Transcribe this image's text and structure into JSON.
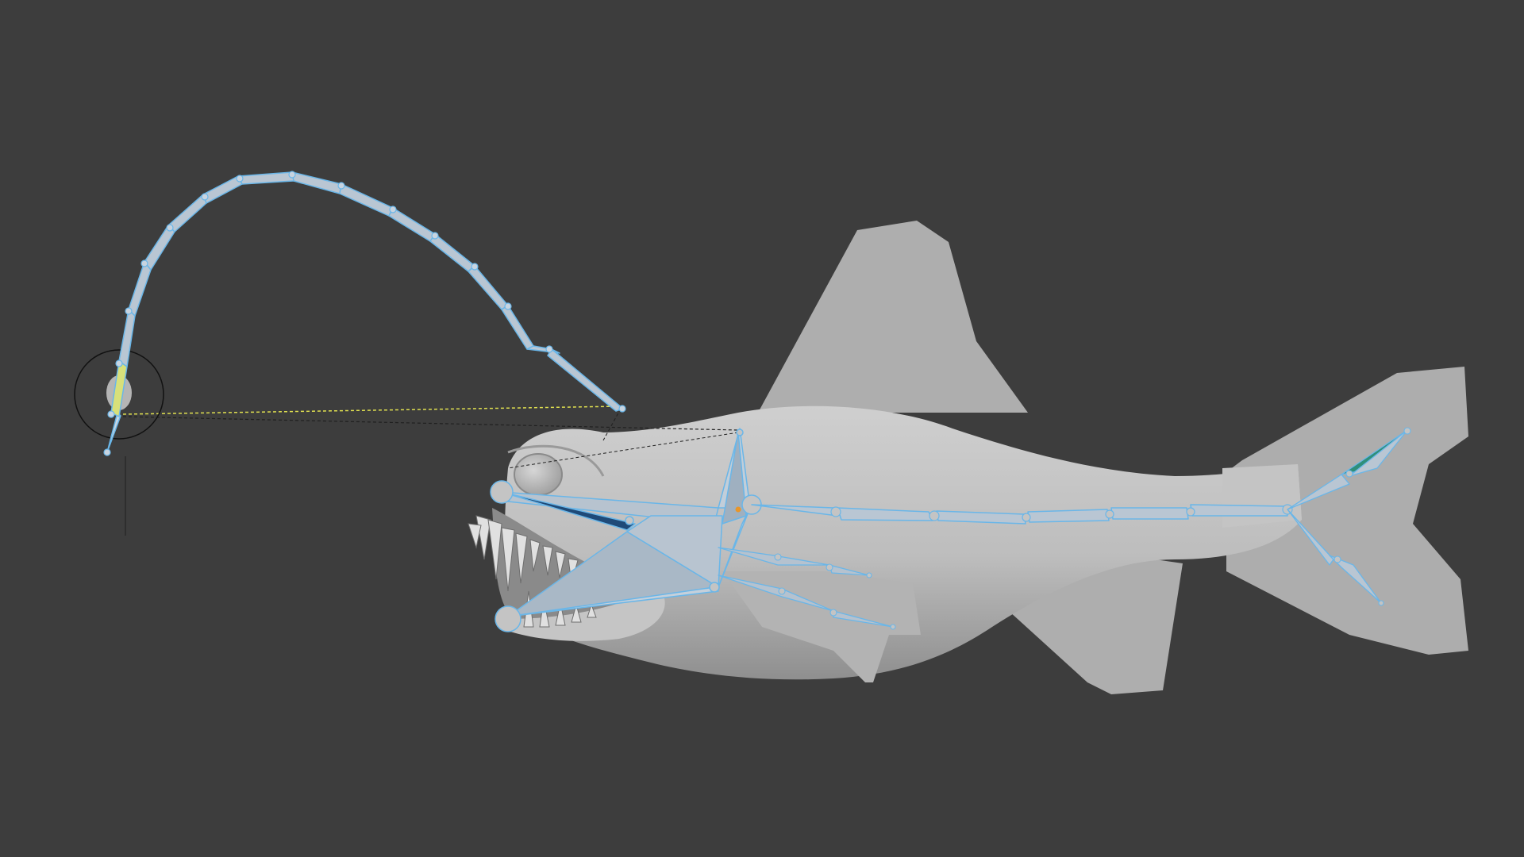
{
  "viewport": {
    "background": "#3d3d3d",
    "mode": "pose-mode"
  },
  "scene": {
    "subject": "anglerfish",
    "colors": {
      "mesh": "#bdbdbd",
      "fin": "#adadad",
      "bone_fill": "#b8c4d0",
      "bone_outline": "#6ab6e8",
      "bone_dark": "#1f4a78",
      "active_bone": "#d8e07a",
      "tail_bone": "#2f8f7a",
      "ik_line": "#e0e050",
      "relation_line": "#202020",
      "pivot": "#e8962a"
    }
  },
  "tools": {
    "rotate_gizmo_icon": "circle-gizmo"
  }
}
